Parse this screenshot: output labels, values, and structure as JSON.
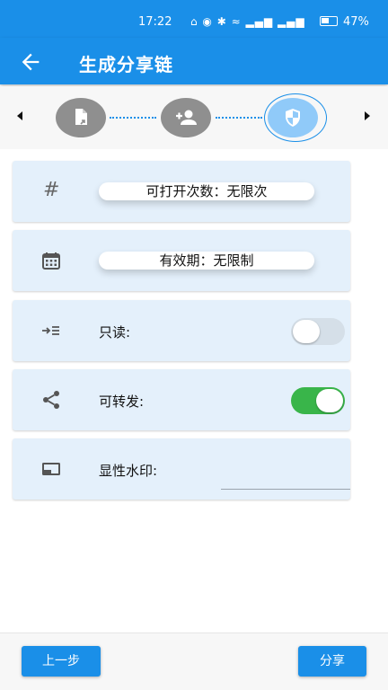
{
  "status_bar": {
    "time": "17:22",
    "icons_text": "⌂ ◉ ✱ ≈ ▂▄▆ ▂▄▆",
    "battery": "47%"
  },
  "app_bar": {
    "title": "生成分享链"
  },
  "stepper": {
    "steps": [
      "file-share-icon",
      "add-user-icon",
      "shield-icon"
    ],
    "active_step": 3
  },
  "settings": {
    "open_count": {
      "icon": "hash-icon",
      "text": "可打开次数：无限次"
    },
    "validity": {
      "icon": "calendar-icon",
      "text": "有效期：无限制"
    },
    "read_only": {
      "icon": "indent-icon",
      "label": "只读:",
      "enabled": false
    },
    "forwardable": {
      "icon": "share-icon",
      "label": "可转发:",
      "enabled": true
    },
    "watermark": {
      "icon": "watermark-icon",
      "label": "显性水印:",
      "value": ""
    }
  },
  "footer": {
    "prev_label": "上一步",
    "share_label": "分享"
  },
  "colors": {
    "primary": "#1a8fe8",
    "card_bg": "#e4f0fb",
    "toggle_on": "#39b54a"
  }
}
